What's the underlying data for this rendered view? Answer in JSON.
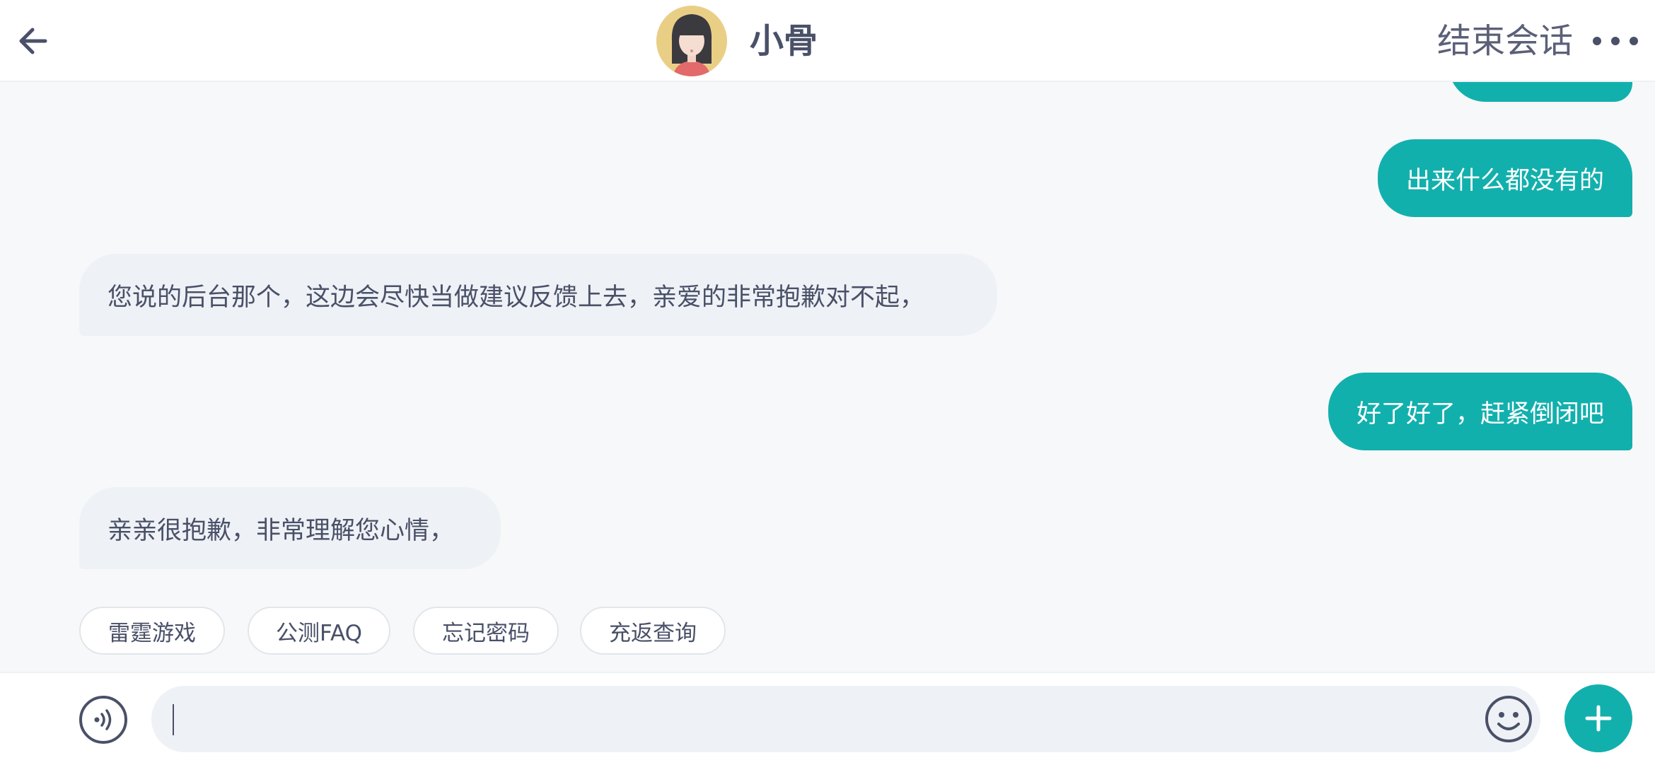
{
  "header": {
    "title": "小骨",
    "end_session_label": "结束会话"
  },
  "messages": {
    "out_1": "出来什么都没有的",
    "in_1": "您说的后台那个，这边会尽快当做建议反馈上去，亲爱的非常抱歉对不起，",
    "out_2": "好了好了，赶紧倒闭吧",
    "in_2": "亲亲很抱歉，非常理解您心情，"
  },
  "quick_replies": [
    "雷霆游戏",
    "公测FAQ",
    "忘记密码",
    "充返查询"
  ],
  "input": {
    "value": ""
  },
  "colors": {
    "accent": "#12b0ad",
    "incoming_bubble": "#eef2f6",
    "text": "#4a5068"
  }
}
